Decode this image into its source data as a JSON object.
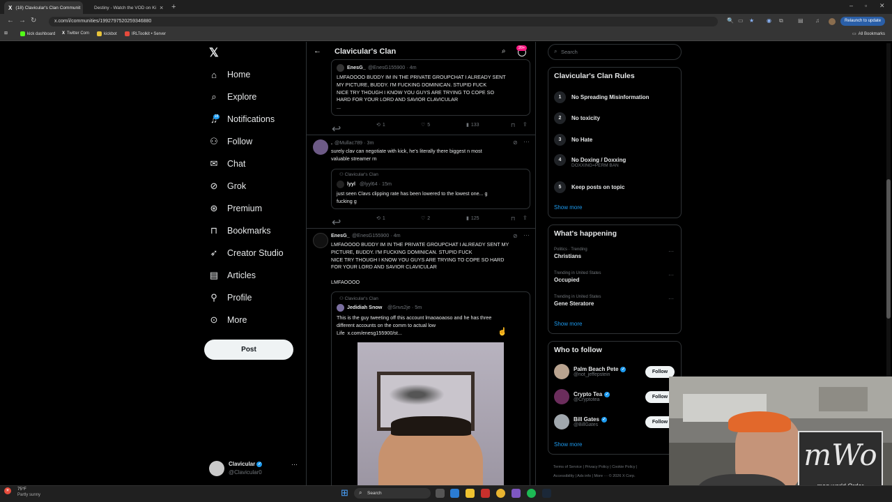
{
  "browser": {
    "tabs": [
      {
        "title": "(18) Clavicular's Clan Communit"
      },
      {
        "title": "Destiny - Watch the VOD on Ki"
      }
    ],
    "url": "x.com/i/communities/1992797520259346880",
    "relaunch_label": "Relaunch to update",
    "bookmarks": [
      "kick dashboard",
      "Twitter Com",
      "kickbot",
      "IRLToolkit • Server"
    ],
    "all_bookmarks": "All Bookmarks"
  },
  "nav": {
    "items": [
      {
        "label": "Home",
        "icon": "home-icon"
      },
      {
        "label": "Explore",
        "icon": "search-icon"
      },
      {
        "label": "Notifications",
        "icon": "bell-icon"
      },
      {
        "label": "Follow",
        "icon": "follow-icon"
      },
      {
        "label": "Chat",
        "icon": "mail-icon"
      },
      {
        "label": "Grok",
        "icon": "grok-icon"
      },
      {
        "label": "Premium",
        "icon": "premium-icon"
      },
      {
        "label": "Bookmarks",
        "icon": "bookmark-icon"
      },
      {
        "label": "Creator Studio",
        "icon": "rocket-icon"
      },
      {
        "label": "Articles",
        "icon": "articles-icon"
      },
      {
        "label": "Profile",
        "icon": "profile-icon"
      },
      {
        "label": "More",
        "icon": "more-icon"
      }
    ],
    "notif_count": "18",
    "post_label": "Post",
    "account": {
      "name": "Clavicular",
      "handle": "@Clavicular0"
    }
  },
  "header": {
    "title": "Clavicular's Clan",
    "badge": "20+"
  },
  "posts": [
    {
      "quote_author": "EnesG_",
      "quote_meta": "@EnesG155900 · 4m",
      "quote_text": "LMFAOOOO BUDDY IM IN THE PRIVATE GROUPCHAT I ALREADY SENT\nMY PICTURE, BUDDY. I'M FUCKING DOMINICAN. STUPID FUCK\nNICE TRY THOUGH I KNOW YOU GUYS ARE TRYING TO COPE SO\nHARD FOR YOUR LORD AND SAVIOR CLAVICULAR\n...",
      "retweets": "1",
      "likes": "5",
      "views": "133"
    },
    {
      "author": ".",
      "meta": "@Mullac789 · 3m",
      "text": "surely clav can negotiate with kick, he's literally there biggest n most\nvaluable streamer rn",
      "quote_community": "Clavicular's Clan",
      "quote_author": "lyyl",
      "quote_meta": "@lyyl64 · 15m",
      "quote_text": "just seen Clavs clipping rate has been lowered to the lowest one... g\nfucking g",
      "retweets": "1",
      "likes": "2",
      "views": "125"
    },
    {
      "author": "EnesG_",
      "meta": "@EnesG155900 · 4m",
      "text": "LMFAOOOO BUDDY IM IN THE PRIVATE GROUPCHAT I ALREADY SENT MY\nPICTURE, BUDDY. I'M FUCKING DOMINICAN. STUPID FUCK\nNICE TRY THOUGH I KNOW YOU GUYS ARE TRYING TO COPE SO HARD\nFOR YOUR LORD AND SAVIOR CLAVICULAR\n\nLMFAOOOO",
      "quote_community": "Clavicular's Clan",
      "quote_author": "Jedidiah Snow",
      "quote_meta": "@Snvs2je · 5m",
      "quote_text": "This is the guy tweeting off this account lmaoaoaoso and he has three\ndifferent accounts on the comm to actual low\nLife  x.com/enesg155900/st..."
    }
  ],
  "search_placeholder": "Search",
  "rules": {
    "title": "Clavicular's Clan Rules",
    "items": [
      {
        "n": "1",
        "label": "No Spreading Misinformation"
      },
      {
        "n": "2",
        "label": "No toxicity"
      },
      {
        "n": "3",
        "label": "No Hate"
      },
      {
        "n": "4",
        "label": "No Doxing / Doxxing",
        "sub": "DOXXING=PERM BAN"
      },
      {
        "n": "5",
        "label": "Keep posts on topic"
      }
    ],
    "show_more": "Show more"
  },
  "happening": {
    "title": "What's happening",
    "items": [
      {
        "cat": "Politics · Trending",
        "name": "Christians"
      },
      {
        "cat": "Trending in United States",
        "name": "Occupied"
      },
      {
        "cat": "Trending in United States",
        "name": "Gene Steratore"
      }
    ],
    "show_more": "Show more"
  },
  "who_to_follow": {
    "title": "Who to follow",
    "items": [
      {
        "name": "Palm Beach Pete",
        "handle": "@not_jeffepstein"
      },
      {
        "name": "Crypto Tea",
        "handle": "@Cryptotea"
      },
      {
        "name": "Bill Gates",
        "handle": "@BillGates"
      }
    ],
    "follow_label": "Follow",
    "show_more": "Show more"
  },
  "footer": {
    "links": [
      "Terms of Service",
      "Privacy Policy",
      "Cookie Policy",
      "Accessibility",
      "Ads info",
      "More ···",
      "© 2026 X Corp."
    ]
  },
  "taskbar": {
    "weather_temp": "75°F",
    "weather_desc": "Partly sunny",
    "search": "Search"
  },
  "overlay": {
    "logo": "mWo",
    "tagline": "mog world Order"
  },
  "colors": {
    "accent": "#1d9bf0",
    "kick": "#53fc18"
  }
}
